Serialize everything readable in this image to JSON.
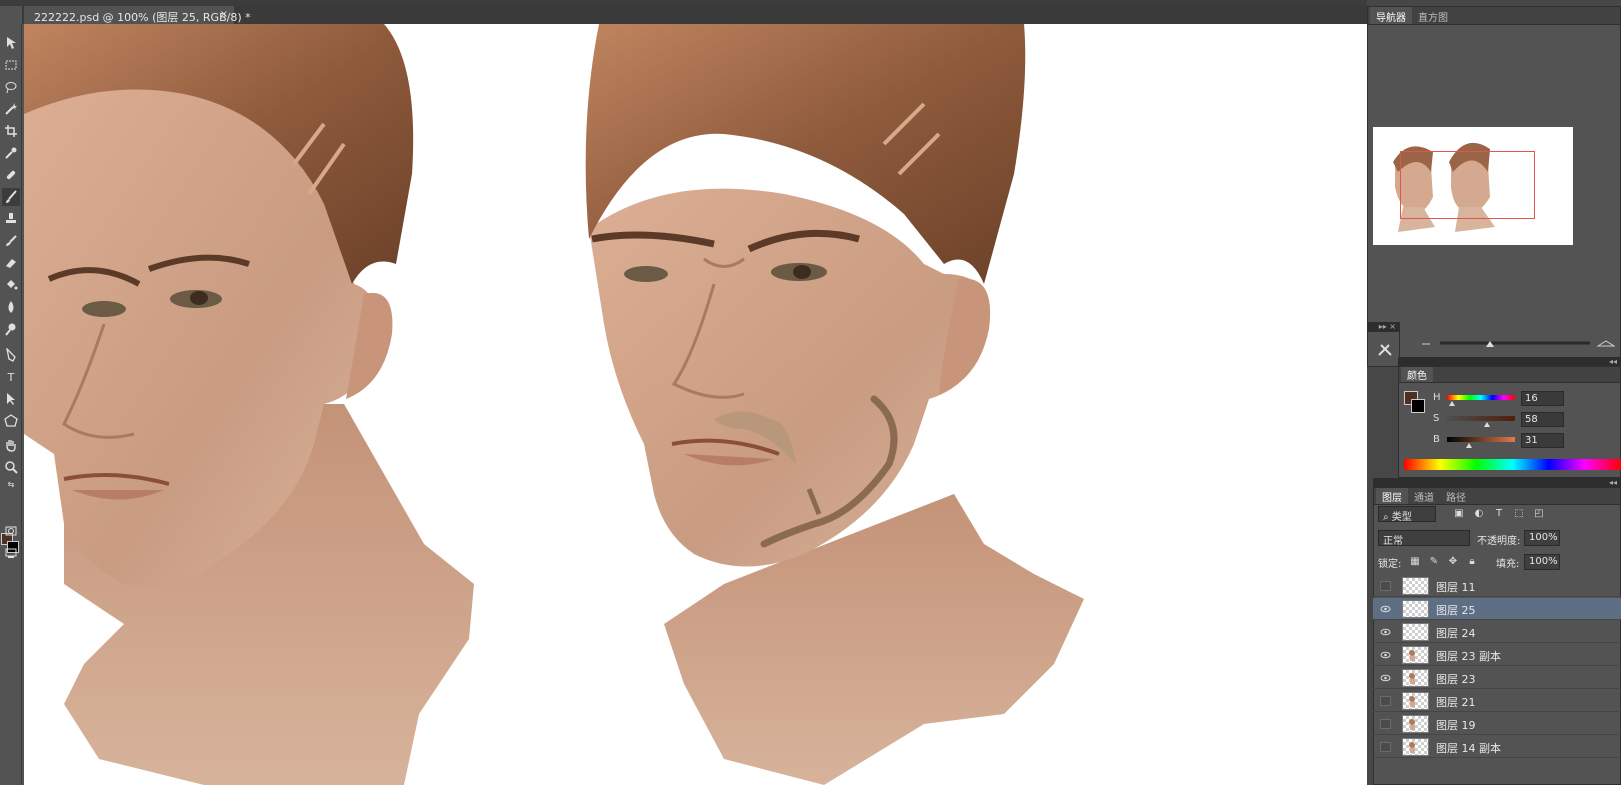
{
  "document": {
    "tab_title": "222222.psd @ 100% (图层 25, RGB/8) *",
    "close_glyph": "×"
  },
  "toolbar": {
    "tools": [
      "move-tool",
      "marquee-tool",
      "lasso-tool",
      "magic-wand-tool",
      "crop-tool",
      "eyedropper-tool",
      "healing-brush-tool",
      "brush-tool",
      "clone-stamp-tool",
      "history-brush-tool",
      "eraser-tool",
      "paint-bucket-tool",
      "blur-tool",
      "dodge-tool",
      "pen-tool",
      "type-tool",
      "path-selection-tool",
      "shape-tool",
      "hand-tool",
      "zoom-tool"
    ],
    "type_glyph": "T",
    "foreground_color": "#4e2f22",
    "background_color": "#000000"
  },
  "navigator": {
    "tabs": [
      "导航器",
      "直方图"
    ],
    "view_box_color": "#e0554e"
  },
  "color": {
    "tab": "颜色",
    "channels": [
      {
        "label": "H",
        "value": "16",
        "fraction": 0.04
      },
      {
        "label": "S",
        "value": "58",
        "fraction": 0.58
      },
      {
        "label": "B",
        "value": "31",
        "fraction": 0.31
      }
    ],
    "swatch_fg": "#4e2f22",
    "swatch_bg": "#000000"
  },
  "layers": {
    "tabs": [
      "图层",
      "通道",
      "路径"
    ],
    "filter_label": "类型",
    "blend_mode": "正常",
    "opacity_label": "不透明度:",
    "opacity_value": "100%",
    "lock_label": "锁定:",
    "fill_label": "填充:",
    "fill_value": "100%",
    "items": [
      {
        "name": "图层 11",
        "visible": false,
        "selected": false,
        "has_art": false
      },
      {
        "name": "图层 25",
        "visible": true,
        "selected": true,
        "has_art": false
      },
      {
        "name": "图层 24",
        "visible": true,
        "selected": false,
        "has_art": false
      },
      {
        "name": "图层 23 副本",
        "visible": true,
        "selected": false,
        "has_art": true
      },
      {
        "name": "图层 23",
        "visible": true,
        "selected": false,
        "has_art": true
      },
      {
        "name": "图层 21",
        "visible": false,
        "selected": false,
        "has_art": true
      },
      {
        "name": "图层 19",
        "visible": false,
        "selected": false,
        "has_art": true
      },
      {
        "name": "图层 14 副本",
        "visible": false,
        "selected": false,
        "has_art": true
      }
    ]
  }
}
